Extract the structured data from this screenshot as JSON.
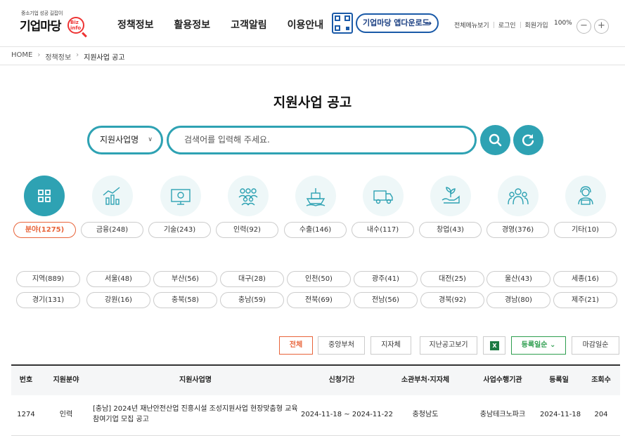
{
  "logo": {
    "slogan": "중소기업 성공 길잡이",
    "name": "기업마당",
    "badge": "Biz info"
  },
  "nav": [
    "정책정보",
    "활용정보",
    "고객알림",
    "이용안내"
  ],
  "app_download": "기업마당 앱다운로드",
  "util": {
    "menu": "전체메뉴보기",
    "login": "로그인",
    "join": "회원가입",
    "zoom": "100%",
    "zoom_out": "−",
    "zoom_in": "+"
  },
  "breadcrumb": [
    "HOME",
    "정책정보",
    "지원사업 공고"
  ],
  "page_title": "지원사업 공고",
  "search": {
    "select_value": "지원사업명",
    "placeholder": "검색어를 입력해 주세요."
  },
  "categories": [
    {
      "label": "분야(1275)",
      "icon": "grid-icon"
    },
    {
      "label": "금융(248)",
      "icon": "finance-chart-icon"
    },
    {
      "label": "기술(243)",
      "icon": "tech-monitor-icon"
    },
    {
      "label": "인력(92)",
      "icon": "people-icon"
    },
    {
      "label": "수출(146)",
      "icon": "ship-icon"
    },
    {
      "label": "내수(117)",
      "icon": "truck-icon"
    },
    {
      "label": "창업(43)",
      "icon": "sprout-hand-icon"
    },
    {
      "label": "경영(376)",
      "icon": "management-people-icon"
    },
    {
      "label": "기타(10)",
      "icon": "support-agent-icon"
    }
  ],
  "regions_row1": [
    "지역(889)",
    "서울(48)",
    "부산(56)",
    "대구(28)",
    "인천(50)",
    "광주(41)",
    "대전(25)",
    "울산(43)",
    "세종(16)"
  ],
  "regions_row2": [
    "경기(131)",
    "강원(16)",
    "충북(58)",
    "충남(59)",
    "전북(69)",
    "전남(56)",
    "경북(92)",
    "경남(80)",
    "제주(21)"
  ],
  "filters": {
    "all": "전체",
    "central": "중앙부처",
    "local": "지자체",
    "past": "지난공고보기",
    "excel": "X",
    "sort_reg": "등록일순",
    "sort_deadline": "마감일순"
  },
  "table": {
    "headers": [
      "번호",
      "지원분야",
      "지원사업명",
      "신청기간",
      "소관부처·지자체",
      "사업수행기관",
      "등록일",
      "조회수"
    ],
    "rows": [
      [
        "1274",
        "인력",
        "[충남] 2024년 재난안전산업 진흥시설 조성지원사업 현장맞춤형 교육 참여기업 모집 공고",
        "2024-11-18 ~ 2024-11-22",
        "충청남도",
        "충남테크노파크",
        "2024-11-18",
        "204"
      ]
    ]
  },
  "colors": {
    "teal": "#2ea2b3",
    "orange": "#e8643a",
    "green": "#2e9e4f",
    "navy": "#1a5aa8"
  }
}
